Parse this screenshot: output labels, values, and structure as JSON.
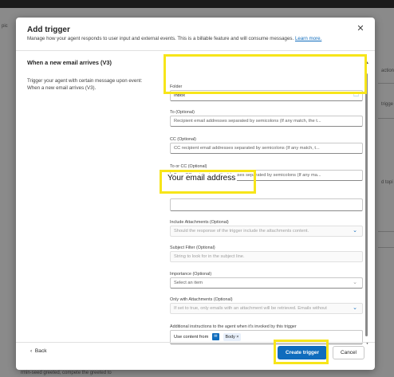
{
  "background": {
    "left_fragment": "pic",
    "right_fragments": [
      "action",
      "trigge",
      "d topi"
    ],
    "bottom_fragment": "rmin-seed greeted, compete the greeted to"
  },
  "dialog": {
    "title": "Add trigger",
    "subtitle": "Manage how your agent responds to user input and external events. This is a billable feature and will consume messages.",
    "learn_more": "Learn more.",
    "close_icon": "close-icon"
  },
  "trigger": {
    "name": "When a new email arrives (V3)",
    "description": "Trigger your agent with certain message upon event: When a new email arrives (V3)."
  },
  "fields": {
    "folder": {
      "label": "Folder",
      "value": "Inbox",
      "icon": "folder-icon"
    },
    "to": {
      "label": "To (Optional)",
      "placeholder": "Recipient email addresses separated by semicolons (If any match, the t..."
    },
    "cc": {
      "label": "CC (Optional)",
      "placeholder": "CC recipient email addresses separated by semicolons (If any match, t..."
    },
    "to_or_cc": {
      "label": "To or CC (Optional)",
      "placeholder": "To or CC recipient email addresses separated by semicolons (If any ma..."
    },
    "from": {
      "value": "Your email address"
    },
    "include_attachments": {
      "label": "Include Attachments (Optional)",
      "placeholder": "Should the response of the trigger include the attachments content."
    },
    "subject_filter": {
      "label": "Subject Filter (Optional)",
      "placeholder": "String to look for in the subject line."
    },
    "importance": {
      "label": "Importance (Optional)",
      "placeholder": "Select an item"
    },
    "only_with_attachments": {
      "label": "Only with Attachments (Optional)",
      "placeholder": "If set to true, only emails with an attachment will be retrieved. Emails without"
    },
    "instructions": {
      "label": "Additional instructions to the agent when it's invoked by this trigger",
      "prefix": "Use content from",
      "chip": "Body",
      "chip_remove": "×"
    }
  },
  "footer": {
    "back": "Back",
    "create": "Create trigger",
    "cancel": "Cancel"
  },
  "colors": {
    "accent": "#0f6cbd",
    "highlight": "#f7e51a"
  }
}
